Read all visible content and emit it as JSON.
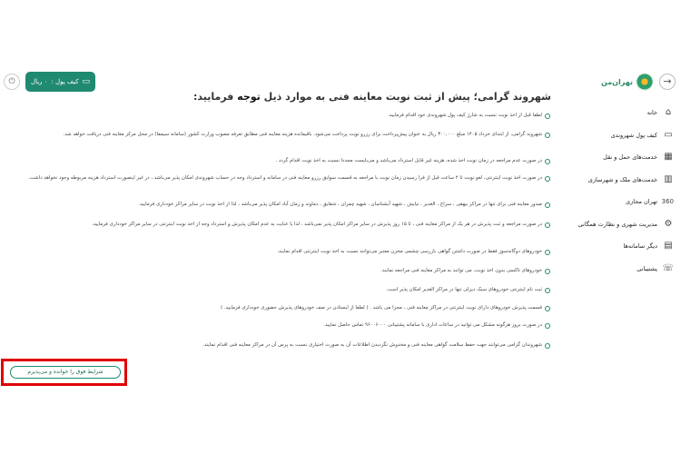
{
  "header": {
    "logo_text": "تهران‌من",
    "wallet_label": "کیف پول :",
    "wallet_value": "۰ ریال"
  },
  "sidebar": {
    "items": [
      {
        "label": "خانه",
        "icon": "home-icon",
        "glyph": "⌂"
      },
      {
        "label": "کیف پول شهروندی",
        "icon": "wallet-icon",
        "glyph": "▭"
      },
      {
        "label": "خدمت‌های حمل و نقل",
        "icon": "bus-icon",
        "glyph": "▦"
      },
      {
        "label": "خدمت‌های ملک و شهرسازی",
        "icon": "building-icon",
        "glyph": "▥"
      },
      {
        "label": "تهران مجازی",
        "icon": "360-icon",
        "glyph": "360"
      },
      {
        "label": "مدیریت شهری و نظارت همگانی",
        "icon": "gear-icon",
        "glyph": "⚙"
      },
      {
        "label": "دیگر سامانه‌ها",
        "icon": "apps-icon",
        "glyph": "▤"
      },
      {
        "label": "پشتیبانی",
        "icon": "support-icon",
        "glyph": "☏"
      }
    ]
  },
  "content": {
    "heading_prefix": "شهروند گرامی؛ پیش از ثبت نوبت معاینه فنی به موارد ذیل",
    "heading_emph": "توجه",
    "heading_suffix": "فرمایید:",
    "bullets": [
      "لطفا قبل از اخذ نوبت نسبت به شارژ کیف پول شهروندی خود اقدام فرمایید.",
      "شهروند گرامی، از ابتدای خرداد ۱۴۰۵ مبلغ ۳۰۰,۰۰۰ ریال به عنوان پیش‌پرداخت برای رزرو نوبت پرداخت می‌شود. باقیمانده هزینه معاینه فنی مطابق تعرفه مصوب وزارت کشور (سامانه سیمفا) در محل مرکز معاینه فنی دریافت خواهد شد.",
      "در صورت عدم مراجعه در زمان نوبت اخذ شده، هزینه غیر قابل استرداد می‌باشد و می‌بایست مجددا نسبت به اخذ نوبت اقدام گردد .",
      "در صورت اخذ نوبت اینترنتی، لغو نوبت تا ۲ ساعت قبل از فرا رسیدن زمان نوبت با مراجعه به قسمت سوابق رزرو معاینه فنی در سامانه و استرداد وجه در حساب شهروندی امکان پذیر می‌باشد ، در غیر اینصورت استرداد هزینه مربوطه وجود نخواهد داشت.",
      "صدور معاینه فنی برای تنها در مراکز بیهقی ، سراج ، الغدیر ، نیایش ، شهید آبشناسان ، شهید چمران ، شقایق ، دماوند و زمان آباد امکان پذیر می‌باشد ، لذا از اخذ نوبت در سایر مراکز خودداری فرمایید.",
      "در صورت مراجعه و ثبت پذیرش در هر یک از مراکز معاینه فنی ، تا ۱۵ روز پذیرش در سایر مراکز امکان پذیر نمی‌باشد . لذا با عنایت به عدم امکان پذیرش و استرداد وجه از اخذ نوبت اینترنتی در سایر مراکز خودداری فرمایید.",
      "خودروهای دوگانه‌سوز فقط در صورت داشتن گواهی بازرسی چشمی مخزن معتبر می‌توانند نسبت به اخذ نوبت اینترنتی اقدام نمایند.",
      "خودروهای تاکسی بدون اخذ نوبت، می توانند به مراکز معاینه فنی مراجعه نمایند.",
      "ثبت نام اینترنتی خودروهای سبک دیزلی تنها در مراکز الغدیر امکان پذیر است.",
      "قسمت پذیرش خودروهای دارای نوبت اینترنتی در مراکز معاینه فنی ، مجزا می باشد . ( لطفا از ایستادن در صف خودروهای پذیرش حضوری خودداری فرمایید. )",
      "در صورت بروز هرگونه مشکل می توانید در ساعات اداری با سامانه پشتیبانی ۹۶۰۰۶۰۰۰ تماس حاصل نمایید.",
      "شهروندان گرامی می‌توانند جهت حفظ سلامت گواهی معاینه فنی و مخدوش نگردیدن اطلاعات آن به صورت اختیاری نسبت به پرس آن در مراکز معاینه فنی اقدام نمایند."
    ],
    "accept_label": "شرایط فوق را خوانده و می‌پذیرم"
  }
}
